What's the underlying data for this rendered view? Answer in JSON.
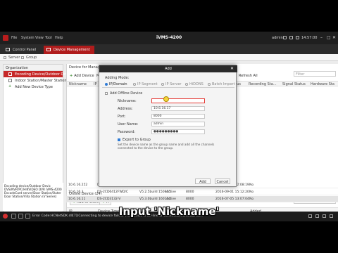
{
  "app": {
    "title": "iVMS-4200",
    "menu": [
      "File",
      "System",
      "View",
      "Tool",
      "Help"
    ],
    "user": "admin",
    "time": "14:57:00"
  },
  "tabs": [
    {
      "label": "Control Panel",
      "active": false
    },
    {
      "label": "Device Management",
      "active": true
    }
  ],
  "subbar": {
    "server": "Server",
    "group": "Group"
  },
  "left_panel": {
    "title": "Organization",
    "items": [
      {
        "label": "Encoding Device/Outdoor Devic",
        "selected": true
      },
      {
        "label": "Indoor Station/Master Station",
        "selected": false
      },
      {
        "label": "Add New Device Type",
        "selected": false
      }
    ]
  },
  "log_text": "Encoding device/Outdoor Devic DVS/NVR/PC/HIKVIDEO DVR iVMS-4200 EncodeCard server/Door Station/Outer Door Station/Villa Station (V Series)",
  "right_panel": {
    "title": "Device for Management",
    "toolbar": {
      "add": "Add Device",
      "mod": "M"
    },
    "filter_label": "Filter",
    "columns": [
      "Nickname",
      "IP",
      "HDD Status",
      "Recording Sta...",
      "Signal Status",
      "Hardware Sta"
    ],
    "refresh_all": "Refresh All",
    "online_title": "Online Device (24)",
    "online_toolbar": {
      "add_to_client": "Add to Client",
      "add": "A"
    },
    "online_filter": "Filter",
    "online_columns": [
      "IP",
      "Device Type",
      "",
      "",
      "",
      "Added"
    ],
    "online_rows": [
      {
        "ip": "10.6.16.252",
        "type": "DS-6704HW-ST",
        "sw": "V1.4.0build 16001",
        "status": "Active",
        "port": "8000",
        "date": "2016-05-09 12:08:19",
        "added": "No"
      },
      {
        "ip": "10.6.16.3",
        "type": "DS-2CD6412FWD/C",
        "sw": "V5.2.5build 150815",
        "status": "Active",
        "port": "8000",
        "date": "2016-09-01 15:12:20",
        "added": "No"
      },
      {
        "ip": "10.6.16.11",
        "type": "DS-2CD3132-V",
        "sw": "V5.3.0build 160114",
        "status": "Active",
        "port": "8000",
        "date": "2016-07-05 13:07:04",
        "added": "No"
      }
    ]
  },
  "dialog": {
    "title": "Add",
    "mode_label": "Adding Mode:",
    "modes": [
      "IP/Domain",
      "IP Segment",
      "IP Server",
      "HiDDNS",
      "Batch Import"
    ],
    "offline_label": "Add Offline Device",
    "fields": [
      {
        "label": "Nickname:",
        "value": ""
      },
      {
        "label": "Address:",
        "value": "10.6.16.17"
      },
      {
        "label": "Port:",
        "value": "8000"
      },
      {
        "label": "User Name:",
        "value": "admin"
      },
      {
        "label": "Password:",
        "value": "●●●●●●●●●"
      }
    ],
    "export_label": "Export to Group",
    "note": "Set the device name as the group name and add all the channels connected to the device to the group.",
    "add_button": "Add",
    "cancel_button": "Cancel"
  },
  "status_message": "Error Code:HCNetSDK.dll[7](Connecting to device failed. The device is off-line or connection timeout ca...",
  "caption": "Input 'Nickname'"
}
